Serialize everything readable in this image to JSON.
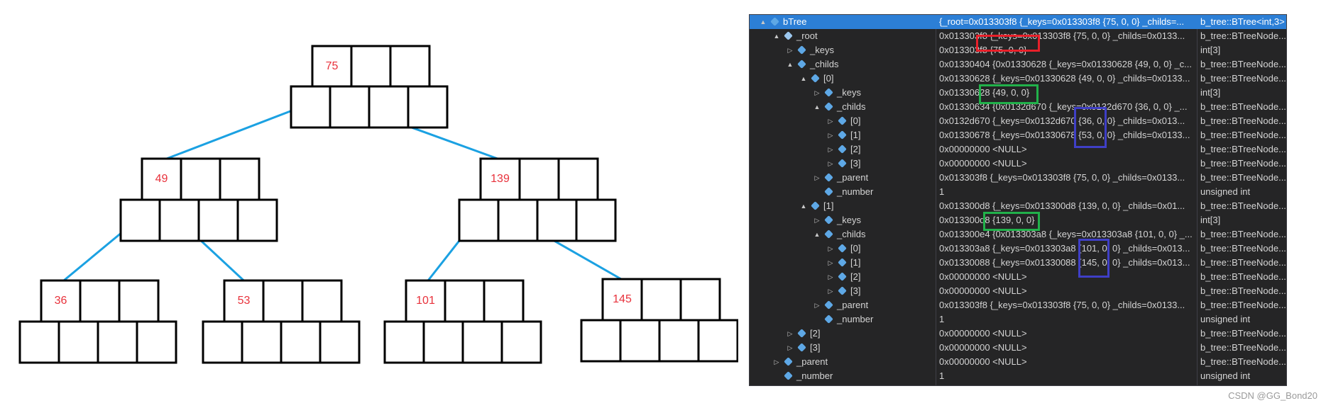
{
  "diagram": {
    "nodes": [
      {
        "id": "n75",
        "key": "75"
      },
      {
        "id": "n49",
        "key": "49"
      },
      {
        "id": "n139",
        "key": "139"
      },
      {
        "id": "n36",
        "key": "36"
      },
      {
        "id": "n53",
        "key": "53"
      },
      {
        "id": "n101",
        "key": "101"
      },
      {
        "id": "n145",
        "key": "145"
      }
    ],
    "edges": [
      [
        "n75",
        "n49"
      ],
      [
        "n75",
        "n139"
      ],
      [
        "n49",
        "n36"
      ],
      [
        "n49",
        "n53"
      ],
      [
        "n139",
        "n101"
      ],
      [
        "n139",
        "n145"
      ]
    ]
  },
  "debugger": {
    "rows": [
      {
        "name": "bTree",
        "value": "{_root=0x013303f8 {_keys=0x013303f8 {75, 0, 0} _childs=...",
        "type": "b_tree::BTree<int,3>",
        "expander": "▲",
        "selected": true
      },
      {
        "name": "_root",
        "value": "0x013303f8 {_keys=0x013303f8 {75, 0, 0} _childs=0x0133...",
        "type": "b_tree::BTreeNode...",
        "expander": "▲"
      },
      {
        "name": "_keys",
        "value": "0x013303f8 {75, 0, 0}",
        "type": "int[3]",
        "expander": "▷"
      },
      {
        "name": "_childs",
        "value": "0x01330404 {0x01330628 {_keys=0x01330628 {49, 0, 0} _c...",
        "type": "b_tree::BTreeNode...",
        "expander": "▲"
      },
      {
        "name": "[0]",
        "value": "0x01330628 {_keys=0x01330628 {49, 0, 0} _childs=0x0133...",
        "type": "b_tree::BTreeNode...",
        "expander": "▲"
      },
      {
        "name": "_keys",
        "value": "0x01330628 {49, 0, 0}",
        "type": "int[3]",
        "expander": "▷"
      },
      {
        "name": "_childs",
        "value": "0x01330634 {0x0132d670 {_keys=0x0132d670 {36, 0, 0} _...",
        "type": "b_tree::BTreeNode...",
        "expander": "▲"
      },
      {
        "name": "[0]",
        "value": "0x0132d670 {_keys=0x0132d670 {36, 0, 0} _childs=0x013...",
        "type": "b_tree::BTreeNode...",
        "expander": "▷"
      },
      {
        "name": "[1]",
        "value": "0x01330678 {_keys=0x01330678 {53, 0, 0} _childs=0x0133...",
        "type": "b_tree::BTreeNode...",
        "expander": "▷"
      },
      {
        "name": "[2]",
        "value": "0x00000000 <NULL>",
        "type": "b_tree::BTreeNode...",
        "expander": "▷"
      },
      {
        "name": "[3]",
        "value": "0x00000000 <NULL>",
        "type": "b_tree::BTreeNode...",
        "expander": "▷"
      },
      {
        "name": "_parent",
        "value": "0x013303f8 {_keys=0x013303f8 {75, 0, 0} _childs=0x0133...",
        "type": "b_tree::BTreeNode...",
        "expander": "▷"
      },
      {
        "name": "_number",
        "value": "1",
        "type": "unsigned int",
        "expander": ""
      },
      {
        "name": "[1]",
        "value": "0x013300d8 {_keys=0x013300d8 {139, 0, 0} _childs=0x01...",
        "type": "b_tree::BTreeNode...",
        "expander": "▲"
      },
      {
        "name": "_keys",
        "value": "0x013300d8 {139, 0, 0}",
        "type": "int[3]",
        "expander": "▷"
      },
      {
        "name": "_childs",
        "value": "0x013300e4 {0x013303a8 {_keys=0x013303a8 {101, 0, 0} _...",
        "type": "b_tree::BTreeNode...",
        "expander": "▲"
      },
      {
        "name": "[0]",
        "value": "0x013303a8 {_keys=0x013303a8 {101, 0, 0} _childs=0x013...",
        "type": "b_tree::BTreeNode...",
        "expander": "▷"
      },
      {
        "name": "[1]",
        "value": "0x01330088 {_keys=0x01330088 {145, 0, 0} _childs=0x013...",
        "type": "b_tree::BTreeNode...",
        "expander": "▷"
      },
      {
        "name": "[2]",
        "value": "0x00000000 <NULL>",
        "type": "b_tree::BTreeNode...",
        "expander": "▷"
      },
      {
        "name": "[3]",
        "value": "0x00000000 <NULL>",
        "type": "b_tree::BTreeNode...",
        "expander": "▷"
      },
      {
        "name": "_parent",
        "value": "0x013303f8 {_keys=0x013303f8 {75, 0, 0} _childs=0x0133...",
        "type": "b_tree::BTreeNode...",
        "expander": "▷"
      },
      {
        "name": "_number",
        "value": "1",
        "type": "unsigned int",
        "expander": ""
      },
      {
        "name": "[2]",
        "value": "0x00000000 <NULL>",
        "type": "b_tree::BTreeNode...",
        "expander": "▷"
      },
      {
        "name": "[3]",
        "value": "0x00000000 <NULL>",
        "type": "b_tree::BTreeNode...",
        "expander": "▷"
      },
      {
        "name": "_parent",
        "value": "0x00000000 <NULL>",
        "type": "b_tree::BTreeNode...",
        "expander": "▷"
      },
      {
        "name": "_number",
        "value": "1",
        "type": "unsigned int",
        "expander": ""
      }
    ]
  },
  "watermark": "CSDN @GG_Bond20"
}
